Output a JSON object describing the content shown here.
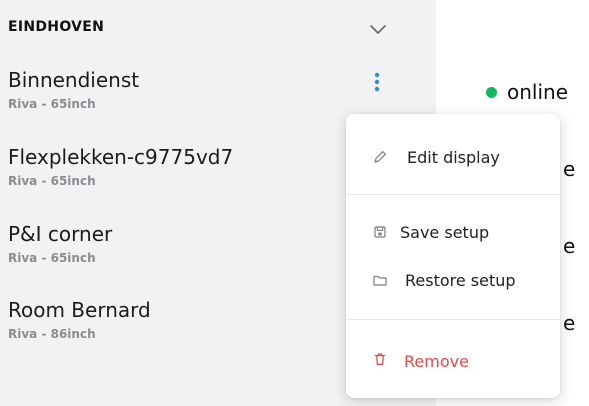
{
  "group": {
    "title": "EINDHOVEN",
    "chevron_icon": "chevron-down-icon"
  },
  "devices": [
    {
      "name": "Binnendienst",
      "model": "Riva - 65inch",
      "status": "online"
    },
    {
      "name": "Flexplekken-c9775vd7",
      "model": "Riva - 65inch",
      "status_fragment": "e"
    },
    {
      "name": "P&I corner",
      "model": "Riva - 65inch",
      "status_fragment": "e"
    },
    {
      "name": "Room Bernard",
      "model": "Riva - 86inch",
      "status_fragment": "e"
    }
  ],
  "menu": {
    "items": [
      {
        "label": "Edit display",
        "icon": "pencil-icon"
      },
      {
        "label": "Save setup",
        "icon": "save-icon"
      },
      {
        "label": "Restore setup",
        "icon": "folder-icon"
      },
      {
        "label": "Remove",
        "icon": "trash-icon",
        "tone": "danger"
      }
    ]
  },
  "colors": {
    "panel_bg": "#f1f2f4",
    "accent_blue": "#2f8fd6",
    "online_green": "#13b85a",
    "danger_red": "#e5484d",
    "muted_text": "#8a8c90"
  }
}
